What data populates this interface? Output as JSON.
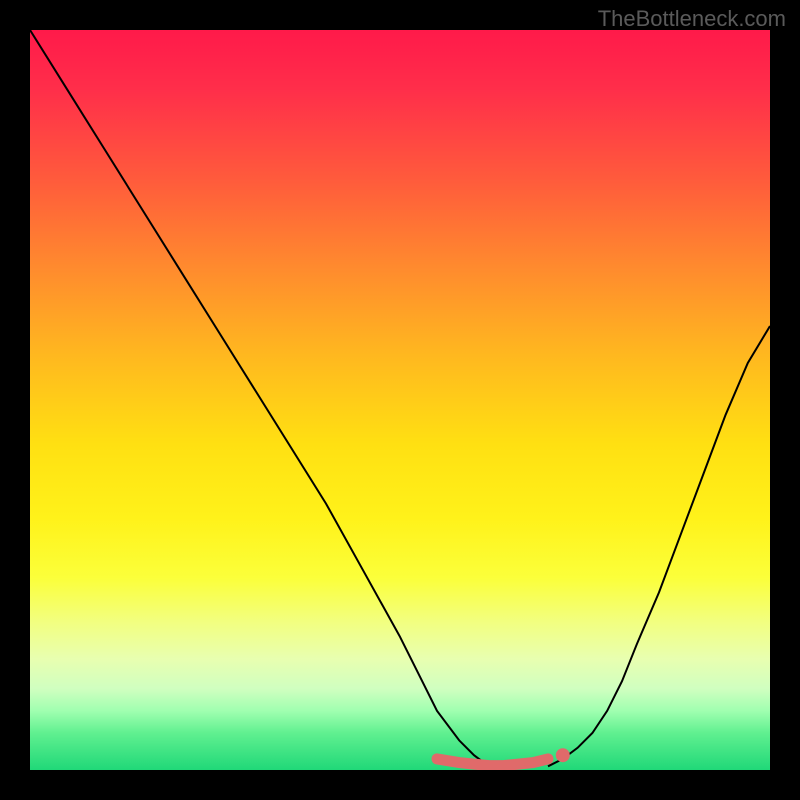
{
  "attribution": "TheBottleneck.com",
  "chart_data": {
    "type": "line",
    "title": "",
    "xlabel": "",
    "ylabel": "",
    "xlim": [
      0,
      100
    ],
    "ylim": [
      0,
      100
    ],
    "grid": false,
    "legend": false,
    "series": [
      {
        "name": "left-curve",
        "x": [
          0,
          5,
          10,
          15,
          20,
          25,
          30,
          35,
          40,
          45,
          50,
          53,
          55,
          58,
          60,
          62
        ],
        "y": [
          100,
          92,
          84,
          76,
          68,
          60,
          52,
          44,
          36,
          27,
          18,
          12,
          8,
          4,
          2,
          0.5
        ]
      },
      {
        "name": "right-curve",
        "x": [
          70,
          72,
          74,
          76,
          78,
          80,
          82,
          85,
          88,
          91,
          94,
          97,
          100
        ],
        "y": [
          0.5,
          1.5,
          3,
          5,
          8,
          12,
          17,
          24,
          32,
          40,
          48,
          55,
          60
        ]
      }
    ],
    "emphasis_segment": {
      "name": "optimal-range",
      "x": [
        55,
        58,
        60,
        62,
        64,
        66,
        68,
        70
      ],
      "y": [
        1.5,
        1.0,
        0.8,
        0.6,
        0.6,
        0.8,
        1.0,
        1.5
      ]
    },
    "marker": {
      "x": 72,
      "y": 2
    },
    "background_gradient": {
      "stops": [
        {
          "pos": 0,
          "color": "#ff1a4a"
        },
        {
          "pos": 50,
          "color": "#ffe012"
        },
        {
          "pos": 80,
          "color": "#f2ff80"
        },
        {
          "pos": 100,
          "color": "#20d878"
        }
      ]
    }
  }
}
